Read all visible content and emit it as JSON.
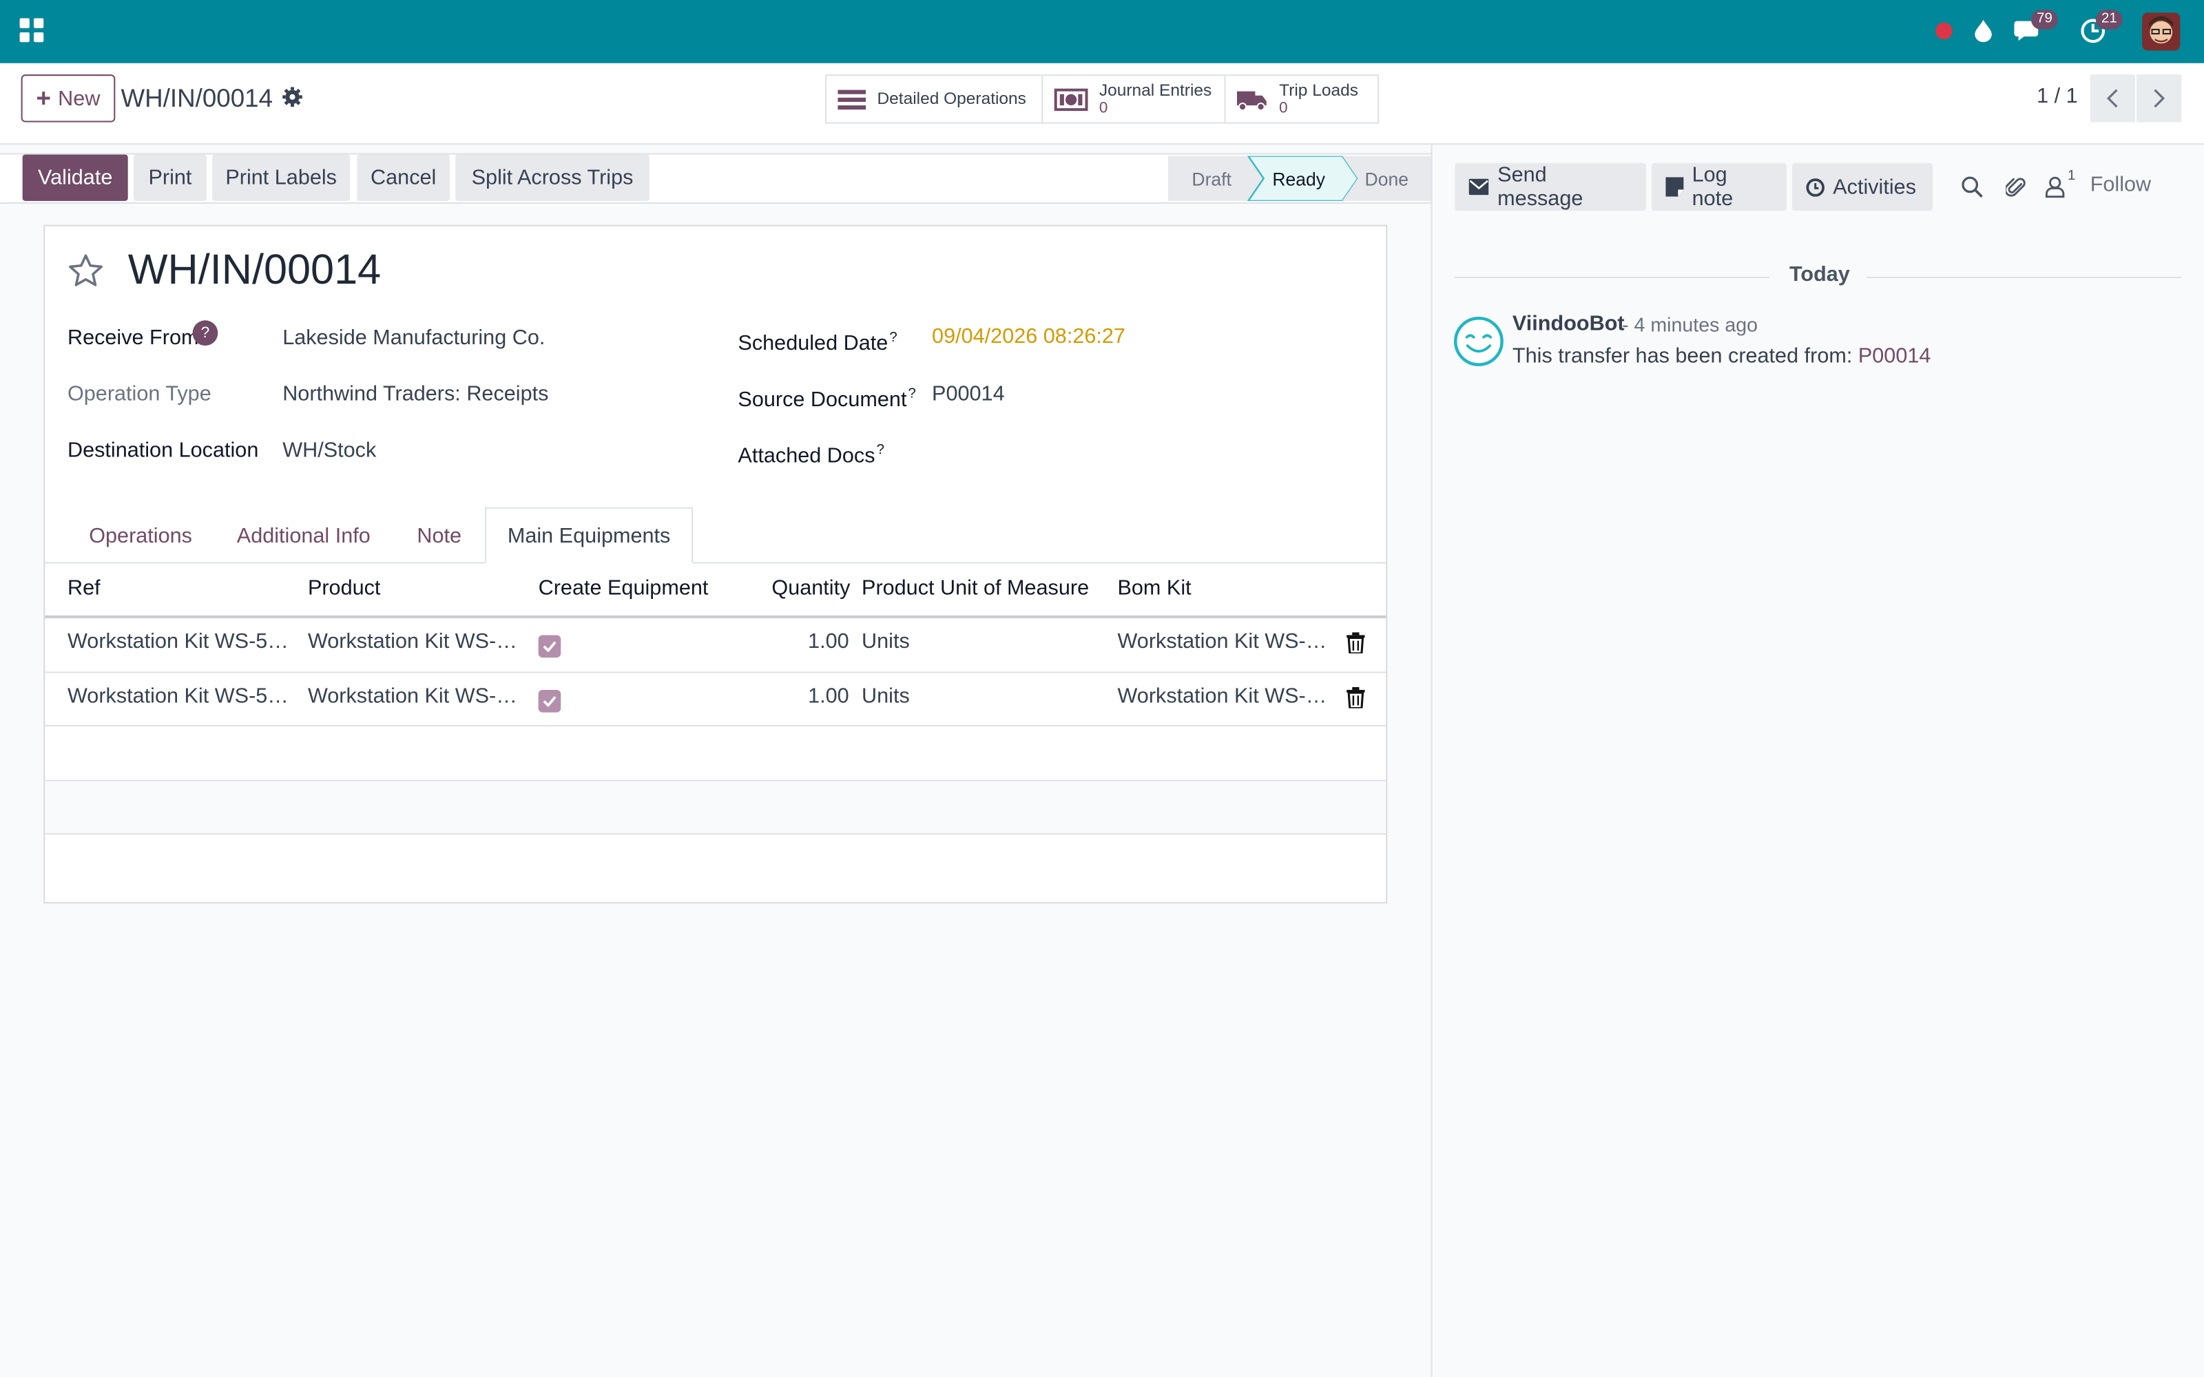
{
  "navbar": {
    "discuss_badge": "79",
    "activity_badge": "21",
    "colors": {
      "bar": "#00879a",
      "badge": "#714b67"
    }
  },
  "control_panel": {
    "new_label": "New",
    "breadcrumb_title": "WH/IN/00014",
    "smart_buttons": [
      {
        "label": "Detailed Operations",
        "value": "",
        "icon": "list-icon"
      },
      {
        "label": "Journal Entries",
        "value": "0",
        "icon": "money-icon"
      },
      {
        "label": "Trip Loads",
        "value": "0",
        "icon": "truck-icon"
      }
    ],
    "pager": "1 / 1"
  },
  "statusbar": {
    "buttons": [
      "Validate",
      "Print",
      "Print Labels",
      "Cancel",
      "Split Across Trips"
    ],
    "stages": [
      "Draft",
      "Ready",
      "Done"
    ],
    "active_stage": "Ready"
  },
  "form": {
    "name": "WH/IN/00014",
    "left_fields": [
      {
        "label": "Receive From",
        "value": "Lakeside Manufacturing Co."
      },
      {
        "label": "Operation Type",
        "value": "Northwind Traders: Receipts"
      },
      {
        "label": "Destination Location",
        "value": "WH/Stock"
      }
    ],
    "right_fields": [
      {
        "label": "Scheduled Date",
        "value": "09/04/2026 08:26:27"
      },
      {
        "label": "Source Document",
        "value": "P00014"
      },
      {
        "label": "Attached Docs",
        "value": ""
      }
    ],
    "help_mark": "?",
    "tabs": [
      "Operations",
      "Additional Info",
      "Note",
      "Main Equipments"
    ],
    "active_tab": "Main Equipments",
    "table": {
      "columns": [
        "Ref",
        "Product",
        "Create Equipment",
        "Quantity",
        "Product Unit of Measure",
        "Bom Kit"
      ],
      "rows": [
        {
          "ref": "Workstation Kit WS-50...",
          "product": "Workstation Kit WS-5...",
          "create_equipment": true,
          "quantity": "1.00",
          "uom": "Units",
          "bom_kit": "Workstation Kit WS-5..."
        },
        {
          "ref": "Workstation Kit WS-50...",
          "product": "Workstation Kit WS-5...",
          "create_equipment": true,
          "quantity": "1.00",
          "uom": "Units",
          "bom_kit": "Workstation Kit WS-5..."
        }
      ]
    }
  },
  "chatter": {
    "send_message": "Send message",
    "log_note": "Log note",
    "activities": "Activities",
    "follower_count": "1",
    "follow": "Follow",
    "date_separator": "Today",
    "message": {
      "author": "ViindooBot",
      "time": "- 4 minutes ago",
      "body": "This transfer has been created from: ",
      "link": "P00014"
    }
  }
}
